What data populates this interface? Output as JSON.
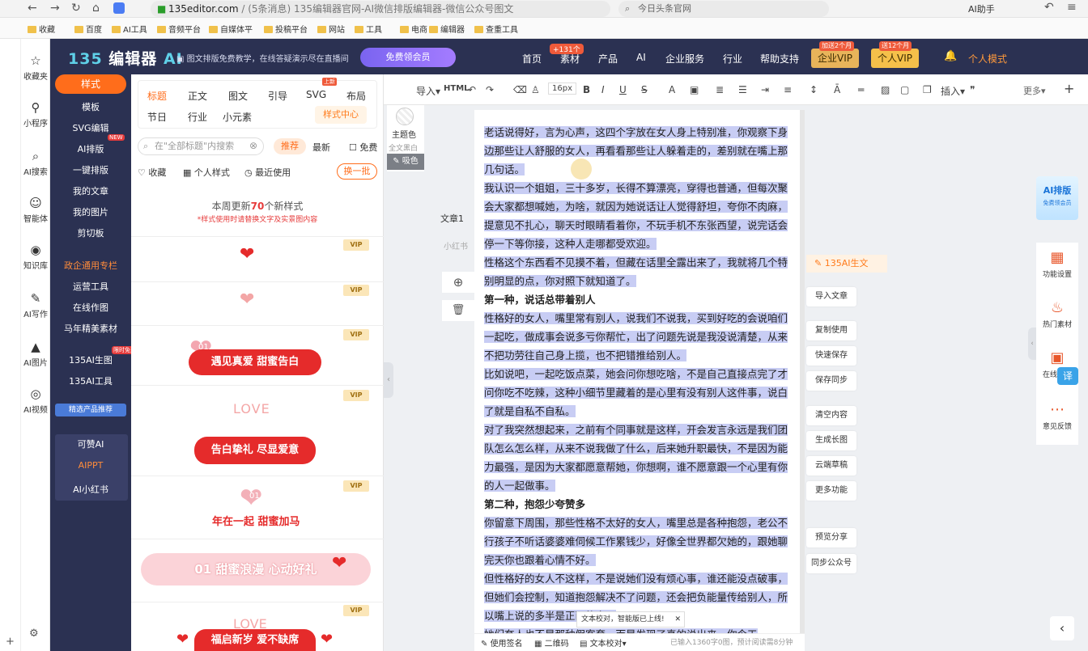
{
  "browser": {
    "domain": "135editor.com",
    "title_rest": " / (5条消息) 135编辑器官网-AI微信排版编辑器-微信公众号图文",
    "search_placeholder": "今日头条官网",
    "ai_helper": "AI助手",
    "bookmarks": [
      "收藏",
      "百度",
      "AI工具",
      "音频平台",
      "自媒体平",
      "投稿平台",
      "网站",
      "工具",
      "电商",
      "编辑器",
      "查重工具"
    ]
  },
  "rail": [
    {
      "icon": "star-icon",
      "label": "收藏夹"
    },
    {
      "icon": "link-icon",
      "label": "小程序"
    },
    {
      "icon": "search-icon",
      "label": "AI搜索"
    },
    {
      "icon": "bot-icon",
      "label": "智能体"
    },
    {
      "icon": "pin-icon",
      "label": "知识库"
    },
    {
      "icon": "pen-icon",
      "label": "AI写作"
    },
    {
      "icon": "image-icon",
      "label": "AI图片"
    },
    {
      "icon": "video-icon",
      "label": "AI视频"
    }
  ],
  "header": {
    "logo_num": "135",
    "logo_text": "编辑器",
    "logo_ai": "AI",
    "note": "▣ 图文排版免费教学，在线答疑演示尽在直播间",
    "vip_button": "免费领会员",
    "nav": [
      "首页",
      "素材",
      "产品",
      "AI",
      "企业服务",
      "行业",
      "帮助支持"
    ],
    "badge": "+131个",
    "enterprise_vip": "企业VIP",
    "enterprise_tag": "加送2个月",
    "personal_vip": "个人VIP",
    "personal_tag": "送12个月",
    "personal_mode": "个人模式"
  },
  "categories": {
    "active": "样式",
    "items": [
      "模板",
      "SVG编辑",
      "AI排版",
      "一键排版",
      "我的文章",
      "我的图片",
      "剪切板"
    ],
    "new_badge": "NEW",
    "section": "政企通用专栏",
    "items2": [
      "运营工具",
      "在线作图",
      "马年精美素材",
      "135AI生图",
      "135AI工具"
    ],
    "free_badge": "限时免费",
    "recommend": "精选产品推荐",
    "cards": [
      "可赞AI",
      "AIPPT",
      "AI小红书"
    ]
  },
  "style_panel": {
    "tabs_row1": [
      "标题",
      "正文",
      "图文",
      "引导",
      "SVG",
      "布局"
    ],
    "tabs_row2": [
      "节日",
      "行业",
      "小元素"
    ],
    "hot": "上新",
    "style_center": "样式中心",
    "search_placeholder": "在\"全部标题\"内搜索",
    "recommend": "推荐",
    "latest": "最新",
    "free": "免费",
    "fav": "收藏",
    "personal": "个人样式",
    "recent": "最近使用",
    "swap": "换一批",
    "update_prefix": "本周更新",
    "update_count": "70",
    "update_suffix": "个新样式",
    "update_note": "*样式使用时请替换文字及实景图内容",
    "vip": "VIP",
    "samples": [
      "01",
      "遇见真爱 甜蜜告白",
      "LOVE",
      "告白挚礼 尽显爱意",
      "01",
      "年在一起 甜蜜加马",
      "01 甜蜜浪漫 心动好礼",
      "LOVE",
      "福启新岁 爱不缺席"
    ]
  },
  "toolbar": {
    "import": "导入▾",
    "html": "HTML",
    "font_size": "16px",
    "insert": "插入▾",
    "more": "更多▾"
  },
  "editor": {
    "theme_color": "主题色",
    "full_black": "全文黑白",
    "pick_color": "吸色",
    "doc_name": "文章1",
    "xhs": "小红书",
    "paragraphs": [
      {
        "bold": false,
        "text": "老话说得好，言为心声，这四个字放在女人身上特别准，你观察下身边那些让人舒服的女人，再看看那些让人躲着走的，差别就在嘴上那几句话。"
      },
      {
        "bold": false,
        "text": "我认识一个姐姐，三十多岁，长得不算漂亮，穿得也普通，但每次聚会大家都想喊她，为啥，就因为她说话让人觉得舒坦，夸你不肉麻，提意见不扎心，聊天时眼睛看着你，不玩手机不东张西望，说完话会停一下等你接，这种人走哪都受欢迎。"
      },
      {
        "bold": false,
        "text": "性格这个东西看不见摸不着，但藏在话里全露出来了，我就将几个特别明显的点，你对照下就知道了。"
      },
      {
        "bold": true,
        "text": "第一种，说话总带着别人"
      },
      {
        "bold": false,
        "text": "性格好的女人，嘴里常有别人，说我们不说我，买到好吃的会说咱们一起吃，做成事会说多亏你帮忙，出了问题先说是我没说清楚，从来不把功劳往自己身上揽，也不把错推给别人。"
      },
      {
        "bold": false,
        "text": "比如说吧，一起吃饭点菜，她会问你想吃啥，不是自己直接点完了才问你吃不吃辣，这种小细节里藏着的是心里有没有别人这件事，说白了就是自私不自私。"
      },
      {
        "bold": false,
        "text": "对了我突然想起来，之前有个同事就是这样，开会发言永远是我们团队怎么怎么样，从来不说我做了什么，后来她升职最快，不是因为能力最强，是因为大家都愿意帮她，你想啊，谁不愿意跟一个心里有你的人一起做事。"
      },
      {
        "bold": true,
        "text": "第二种，抱怨少夸赞多"
      },
      {
        "bold": false,
        "text": "你留意下周围，那些性格不太好的女人，嘴里总是各种抱怨，老公不行孩子不听话婆婆难伺候工作累钱少，好像全世界都欠她的，跟她聊完天你也跟着心情不好。"
      },
      {
        "bold": false,
        "text": "但性格好的女人不这样，不是说她们没有烦心事，谁还能没点破事，但她们会控制，知道抱怨解决不了问题，还会把负能量传给别人，所以嘴上说的多半是正面的事。"
      },
      {
        "bold": false,
        "text": "她们夸人也不是那种假客套，而是发现了真的说出来，你今天"
      }
    ],
    "tooltip": "文本校对，智能版已上线!",
    "bottom": [
      "使用签名",
      "二维码",
      "文本校对▾"
    ],
    "word_count": "已输入1360字0图，预计阅读需8分钟"
  },
  "right_actions": {
    "ai_gen": "135AI生文",
    "buttons": [
      "导入文章",
      "复制使用",
      "快速保存",
      "保存同步",
      "清空内容",
      "生成长图",
      "云端草稿",
      "更多功能",
      "预览分享",
      "同步公众号"
    ]
  },
  "right_col": {
    "banner": "AI排版",
    "banner_sub": "免费领会员",
    "items": [
      {
        "icon": "grid-icon",
        "label": "功能设置"
      },
      {
        "icon": "flame-icon",
        "label": "热门素材"
      },
      {
        "icon": "picture-icon",
        "label": "在线作图"
      },
      {
        "icon": "chat-icon",
        "label": "意见反馈"
      }
    ],
    "translate": "译"
  }
}
